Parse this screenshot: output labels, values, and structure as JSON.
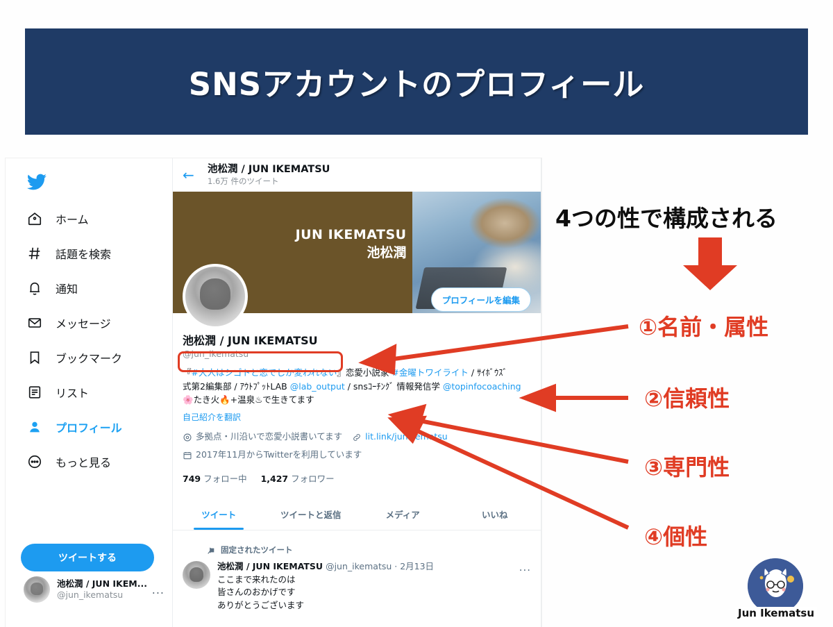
{
  "slide": {
    "title": "SNSアカウントのプロフィール",
    "banner_color": "#1f3b66"
  },
  "annotations": {
    "heading": "4つの性で構成される",
    "accent_color": "#e03c24",
    "items": [
      {
        "label": "①名前・属性"
      },
      {
        "label": "②信頼性"
      },
      {
        "label": "③専門性"
      },
      {
        "label": "④個性"
      }
    ]
  },
  "twitter": {
    "sidebar": {
      "logo": "twitter-bird-icon",
      "items": [
        {
          "label": "ホーム",
          "icon": "home-icon",
          "active": false
        },
        {
          "label": "話題を検索",
          "icon": "hashtag-icon",
          "active": false
        },
        {
          "label": "通知",
          "icon": "bell-icon",
          "active": false
        },
        {
          "label": "メッセージ",
          "icon": "envelope-icon",
          "active": false
        },
        {
          "label": "ブックマーク",
          "icon": "bookmark-icon",
          "active": false
        },
        {
          "label": "リスト",
          "icon": "list-icon",
          "active": false
        },
        {
          "label": "プロフィール",
          "icon": "person-icon",
          "active": true
        },
        {
          "label": "もっと見る",
          "icon": "more-dots-icon",
          "active": false
        }
      ],
      "tweet_button": "ツイートする",
      "account": {
        "name": "池松潤 / JUN IKEM...",
        "handle": "@jun_ikematsu",
        "menu": "..."
      }
    },
    "header": {
      "back": "←",
      "name": "池松潤 / JUN IKEMATSU",
      "tweet_count": "1.6万 件のツイート"
    },
    "banner": {
      "line1": "JUN IKEMATSU",
      "line2": "池松潤",
      "bg_color": "#6b5429"
    },
    "edit_button": "プロフィールを編集",
    "profile": {
      "name": "池松潤 / JUN IKEMATSU",
      "handle": "@jun_ikematsu",
      "bio_line1_a": "『",
      "bio_line1_tag1": "#大人はシゴトと恋でしか変われない",
      "bio_line1_b": "』恋愛小説家 ",
      "bio_line1_tag2": "#金曜トワイライト",
      "bio_line1_c": " / ｻｲﾎﾞｳｽﾞ",
      "bio_line2_a": "式第2編集部 / ｱｳﾄﾌﾟｯﾄLAB ",
      "bio_line2_mention1": "@lab_output",
      "bio_line2_b": " / snsｺｰﾁﾝｸﾞ 情報発信学 ",
      "bio_line2_mention2": "@topinfocoaching",
      "bio_line3": "🌸たき火🔥+温泉♨で生きてます",
      "translate": "自己紹介を翻訳",
      "location": "多拠点・川沿いで恋愛小説書いてます",
      "website": "lit.link/junikematsu",
      "joined": "2017年11月からTwitterを利用しています",
      "following_count": "749",
      "following_label": "フォロー中",
      "followers_count": "1,427",
      "followers_label": "フォロワー"
    },
    "tabs": [
      {
        "label": "ツイート",
        "active": true
      },
      {
        "label": "ツイートと返信",
        "active": false
      },
      {
        "label": "メディア",
        "active": false
      },
      {
        "label": "いいね",
        "active": false
      }
    ],
    "pinned": {
      "label": "固定されたツイート",
      "author": "池松潤 / JUN IKEMATSU",
      "handle": "@jun_ikematsu",
      "separator": " · ",
      "date": "2月13日",
      "text": "ここまで来れたのは\n皆さんのおかげです\nありがとうございます",
      "menu": "..."
    }
  },
  "brand": {
    "name": "Jun Ikematsu"
  }
}
